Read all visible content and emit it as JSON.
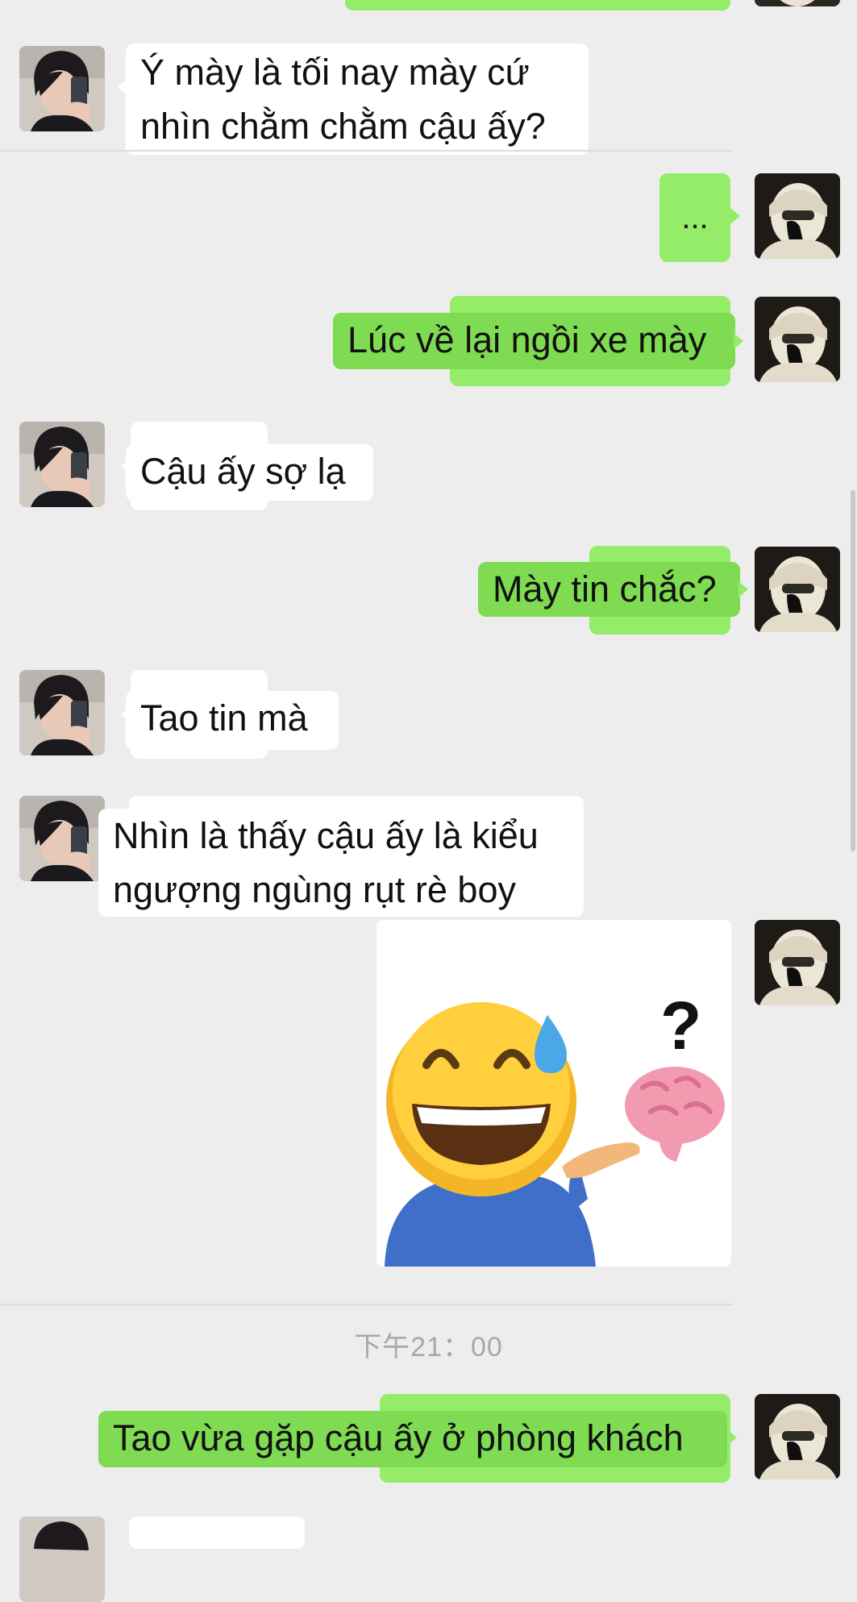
{
  "chat": {
    "messages": [
      {
        "id": "m1",
        "side": "left",
        "lines": [
          "Ý mày là tối nay mày cứ",
          "nhìn chằm chằm cậu ấy?"
        ]
      },
      {
        "id": "m2",
        "side": "right",
        "lines": [
          "..."
        ]
      },
      {
        "id": "m3",
        "side": "right",
        "lines": [
          "Lúc về lại ngồi xe mày"
        ]
      },
      {
        "id": "m4",
        "side": "left",
        "lines": [
          "Cậu ấy sợ lạ"
        ]
      },
      {
        "id": "m5",
        "side": "right",
        "lines": [
          "Mày tin chắc?"
        ]
      },
      {
        "id": "m6",
        "side": "left",
        "lines": [
          "Tao tin mà"
        ]
      },
      {
        "id": "m7",
        "side": "left",
        "lines": [
          "Nhìn là thấy cậu ấy là kiểu",
          "ngượng ngùng rụt rè boy"
        ]
      },
      {
        "id": "m8",
        "side": "right",
        "type": "sticker",
        "sticker": "grinning-sweat-emoji-with-brain-question-sticker"
      },
      {
        "id": "m9",
        "side": "right",
        "lines": [
          "Tao vừa gặp cậu ấy ở phòng khách"
        ]
      }
    ],
    "timestamp": "下午21：00"
  },
  "colors": {
    "background": "#ededed",
    "incoming_bubble": "#ffffff",
    "outgoing_bubble": "#95ec69",
    "timestamp_text": "#a8a8a8"
  },
  "icons": {
    "left_avatar": "selfie-person-avatar",
    "right_avatar": "masked-person-avatar"
  }
}
